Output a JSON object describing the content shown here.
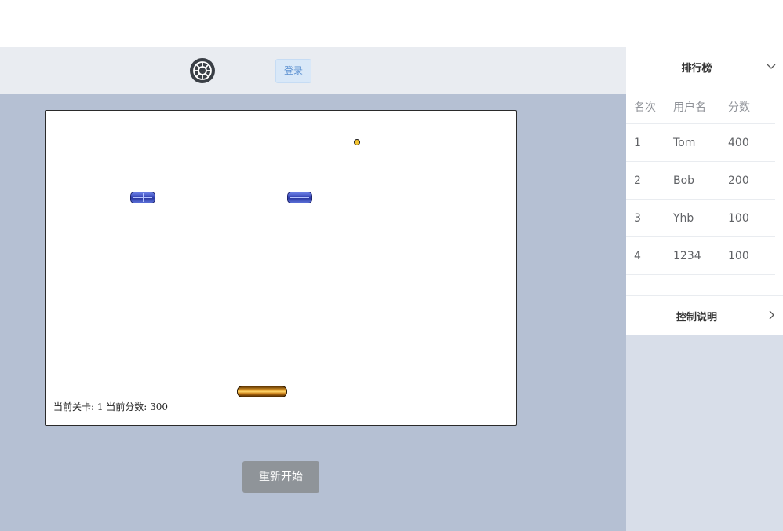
{
  "header": {
    "login_label": "登录"
  },
  "game": {
    "status": "当前关卡: 1 当前分数: 300",
    "level": 1,
    "score": 300,
    "brick_color": "#3848b8",
    "paddle_color": "#e09a2a",
    "ball_color": "#f4c430"
  },
  "restart_label": "重新开始",
  "leaderboard": {
    "title": "排行榜",
    "columns": [
      "名次",
      "用户名",
      "分数"
    ],
    "rows": [
      {
        "rank": "1",
        "user": "Tom",
        "score": "400"
      },
      {
        "rank": "2",
        "user": "Bob",
        "score": "200"
      },
      {
        "rank": "3",
        "user": "Yhb",
        "score": "100"
      },
      {
        "rank": "4",
        "user": "1234",
        "score": "100"
      }
    ]
  },
  "controls": {
    "title": "控制说明"
  },
  "icons": {
    "logo": "gear-logo-icon",
    "leaderboard_toggle": "chevron-down-icon",
    "controls_toggle": "chevron-right-icon"
  }
}
